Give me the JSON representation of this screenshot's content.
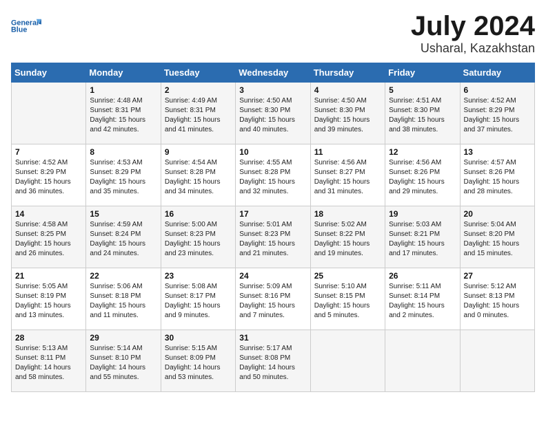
{
  "header": {
    "logo_line1": "General",
    "logo_line2": "Blue",
    "month_title": "July 2024",
    "location": "Usharal, Kazakhstan"
  },
  "days_of_week": [
    "Sunday",
    "Monday",
    "Tuesday",
    "Wednesday",
    "Thursday",
    "Friday",
    "Saturday"
  ],
  "weeks": [
    [
      {
        "day": "",
        "sunrise": "",
        "sunset": "",
        "daylight": ""
      },
      {
        "day": "1",
        "sunrise": "Sunrise: 4:48 AM",
        "sunset": "Sunset: 8:31 PM",
        "daylight": "Daylight: 15 hours and 42 minutes."
      },
      {
        "day": "2",
        "sunrise": "Sunrise: 4:49 AM",
        "sunset": "Sunset: 8:31 PM",
        "daylight": "Daylight: 15 hours and 41 minutes."
      },
      {
        "day": "3",
        "sunrise": "Sunrise: 4:50 AM",
        "sunset": "Sunset: 8:30 PM",
        "daylight": "Daylight: 15 hours and 40 minutes."
      },
      {
        "day": "4",
        "sunrise": "Sunrise: 4:50 AM",
        "sunset": "Sunset: 8:30 PM",
        "daylight": "Daylight: 15 hours and 39 minutes."
      },
      {
        "day": "5",
        "sunrise": "Sunrise: 4:51 AM",
        "sunset": "Sunset: 8:30 PM",
        "daylight": "Daylight: 15 hours and 38 minutes."
      },
      {
        "day": "6",
        "sunrise": "Sunrise: 4:52 AM",
        "sunset": "Sunset: 8:29 PM",
        "daylight": "Daylight: 15 hours and 37 minutes."
      }
    ],
    [
      {
        "day": "7",
        "sunrise": "Sunrise: 4:52 AM",
        "sunset": "Sunset: 8:29 PM",
        "daylight": "Daylight: 15 hours and 36 minutes."
      },
      {
        "day": "8",
        "sunrise": "Sunrise: 4:53 AM",
        "sunset": "Sunset: 8:29 PM",
        "daylight": "Daylight: 15 hours and 35 minutes."
      },
      {
        "day": "9",
        "sunrise": "Sunrise: 4:54 AM",
        "sunset": "Sunset: 8:28 PM",
        "daylight": "Daylight: 15 hours and 34 minutes."
      },
      {
        "day": "10",
        "sunrise": "Sunrise: 4:55 AM",
        "sunset": "Sunset: 8:28 PM",
        "daylight": "Daylight: 15 hours and 32 minutes."
      },
      {
        "day": "11",
        "sunrise": "Sunrise: 4:56 AM",
        "sunset": "Sunset: 8:27 PM",
        "daylight": "Daylight: 15 hours and 31 minutes."
      },
      {
        "day": "12",
        "sunrise": "Sunrise: 4:56 AM",
        "sunset": "Sunset: 8:26 PM",
        "daylight": "Daylight: 15 hours and 29 minutes."
      },
      {
        "day": "13",
        "sunrise": "Sunrise: 4:57 AM",
        "sunset": "Sunset: 8:26 PM",
        "daylight": "Daylight: 15 hours and 28 minutes."
      }
    ],
    [
      {
        "day": "14",
        "sunrise": "Sunrise: 4:58 AM",
        "sunset": "Sunset: 8:25 PM",
        "daylight": "Daylight: 15 hours and 26 minutes."
      },
      {
        "day": "15",
        "sunrise": "Sunrise: 4:59 AM",
        "sunset": "Sunset: 8:24 PM",
        "daylight": "Daylight: 15 hours and 24 minutes."
      },
      {
        "day": "16",
        "sunrise": "Sunrise: 5:00 AM",
        "sunset": "Sunset: 8:23 PM",
        "daylight": "Daylight: 15 hours and 23 minutes."
      },
      {
        "day": "17",
        "sunrise": "Sunrise: 5:01 AM",
        "sunset": "Sunset: 8:23 PM",
        "daylight": "Daylight: 15 hours and 21 minutes."
      },
      {
        "day": "18",
        "sunrise": "Sunrise: 5:02 AM",
        "sunset": "Sunset: 8:22 PM",
        "daylight": "Daylight: 15 hours and 19 minutes."
      },
      {
        "day": "19",
        "sunrise": "Sunrise: 5:03 AM",
        "sunset": "Sunset: 8:21 PM",
        "daylight": "Daylight: 15 hours and 17 minutes."
      },
      {
        "day": "20",
        "sunrise": "Sunrise: 5:04 AM",
        "sunset": "Sunset: 8:20 PM",
        "daylight": "Daylight: 15 hours and 15 minutes."
      }
    ],
    [
      {
        "day": "21",
        "sunrise": "Sunrise: 5:05 AM",
        "sunset": "Sunset: 8:19 PM",
        "daylight": "Daylight: 15 hours and 13 minutes."
      },
      {
        "day": "22",
        "sunrise": "Sunrise: 5:06 AM",
        "sunset": "Sunset: 8:18 PM",
        "daylight": "Daylight: 15 hours and 11 minutes."
      },
      {
        "day": "23",
        "sunrise": "Sunrise: 5:08 AM",
        "sunset": "Sunset: 8:17 PM",
        "daylight": "Daylight: 15 hours and 9 minutes."
      },
      {
        "day": "24",
        "sunrise": "Sunrise: 5:09 AM",
        "sunset": "Sunset: 8:16 PM",
        "daylight": "Daylight: 15 hours and 7 minutes."
      },
      {
        "day": "25",
        "sunrise": "Sunrise: 5:10 AM",
        "sunset": "Sunset: 8:15 PM",
        "daylight": "Daylight: 15 hours and 5 minutes."
      },
      {
        "day": "26",
        "sunrise": "Sunrise: 5:11 AM",
        "sunset": "Sunset: 8:14 PM",
        "daylight": "Daylight: 15 hours and 2 minutes."
      },
      {
        "day": "27",
        "sunrise": "Sunrise: 5:12 AM",
        "sunset": "Sunset: 8:13 PM",
        "daylight": "Daylight: 15 hours and 0 minutes."
      }
    ],
    [
      {
        "day": "28",
        "sunrise": "Sunrise: 5:13 AM",
        "sunset": "Sunset: 8:11 PM",
        "daylight": "Daylight: 14 hours and 58 minutes."
      },
      {
        "day": "29",
        "sunrise": "Sunrise: 5:14 AM",
        "sunset": "Sunset: 8:10 PM",
        "daylight": "Daylight: 14 hours and 55 minutes."
      },
      {
        "day": "30",
        "sunrise": "Sunrise: 5:15 AM",
        "sunset": "Sunset: 8:09 PM",
        "daylight": "Daylight: 14 hours and 53 minutes."
      },
      {
        "day": "31",
        "sunrise": "Sunrise: 5:17 AM",
        "sunset": "Sunset: 8:08 PM",
        "daylight": "Daylight: 14 hours and 50 minutes."
      },
      {
        "day": "",
        "sunrise": "",
        "sunset": "",
        "daylight": ""
      },
      {
        "day": "",
        "sunrise": "",
        "sunset": "",
        "daylight": ""
      },
      {
        "day": "",
        "sunrise": "",
        "sunset": "",
        "daylight": ""
      }
    ]
  ]
}
